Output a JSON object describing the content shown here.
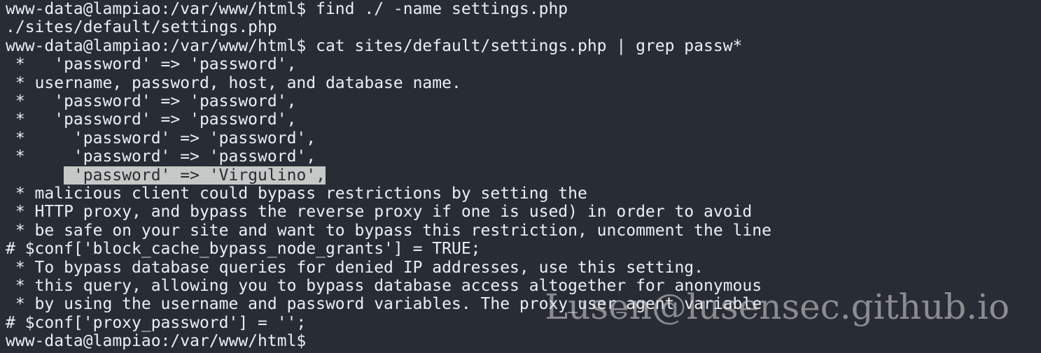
{
  "terminal": {
    "prompt": "www-data@lampiao:/var/www/html$",
    "lines": [
      "www-data@lampiao:/var/www/html$ find ./ -name settings.php",
      "./sites/default/settings.php",
      "www-data@lampiao:/var/www/html$ cat sites/default/settings.php | grep passw*",
      " *   'password' => 'password',",
      " * username, password, host, and database name.",
      " *   'password' => 'password',",
      " *   'password' => 'password',",
      " *     'password' => 'password',",
      " *     'password' => 'password',",
      "      ",
      " * malicious client could bypass restrictions by setting the",
      " * HTTP proxy, and bypass the reverse proxy if one is used) in order to avoid",
      " * be safe on your site and want to bypass this restriction, uncomment the line",
      "# $conf['block_cache_bypass_node_grants'] = TRUE;",
      " * To bypass database queries for denied IP addresses, use this setting.",
      " * this query, allowing you to bypass database access altogether for anonymous",
      " * by using the username and password variables. The proxy_user_agent variable",
      "# $conf['proxy_password'] = '';",
      "www-data@lampiao:/var/www/html$"
    ],
    "highlighted_text": "'password' => 'Virgulino',"
  },
  "watermark": "Lusen@lusensec.github.io",
  "colors": {
    "background": "#282c34",
    "foreground": "#eceff4",
    "selection": "#c5c8c6"
  }
}
